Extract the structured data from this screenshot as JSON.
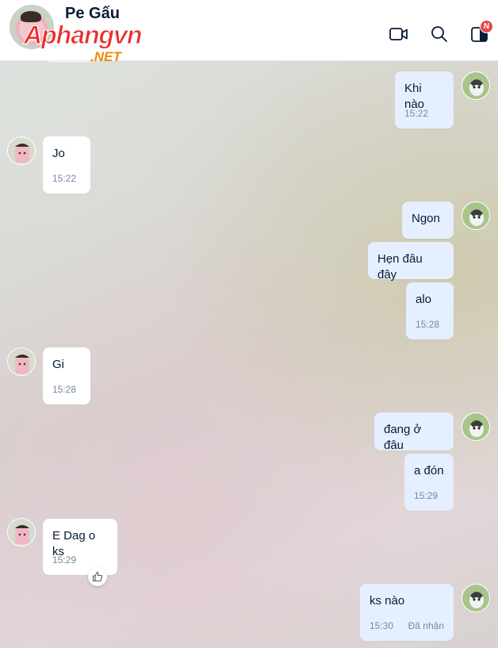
{
  "header": {
    "contact_name": "Pe Gấu",
    "watermark_main": "Aphangvn",
    "watermark_sub": ".NET",
    "icons": {
      "video_call": "video-camera-icon",
      "search": "search-icon",
      "sidebar": "sidebar-panel-icon"
    },
    "notification_badge": "N"
  },
  "messages": [
    {
      "side": "out",
      "text": "Khi nào",
      "time": "15:22"
    },
    {
      "side": "in",
      "text": "Jo",
      "time": "15:22"
    },
    {
      "side": "out",
      "text": "Ngon",
      "time": ""
    },
    {
      "side": "out",
      "text": "Hẹn đâu đây",
      "time": ""
    },
    {
      "side": "out",
      "text": "alo",
      "time": "15:28"
    },
    {
      "side": "in",
      "text": "Gi",
      "time": "15:28"
    },
    {
      "side": "out",
      "text": "đang ở đâu",
      "time": ""
    },
    {
      "side": "out",
      "text": "a đón",
      "time": "15:29"
    },
    {
      "side": "in",
      "text": "E Dag o ks",
      "time": "15:29"
    },
    {
      "side": "out",
      "text": "ks nào",
      "time": "15:30",
      "status": "Đã nhận"
    }
  ],
  "colors": {
    "outgoing_bubble": "#e5efff",
    "incoming_bubble": "#ffffff",
    "timestamp": "#7589a3",
    "badge": "#e5484d"
  }
}
